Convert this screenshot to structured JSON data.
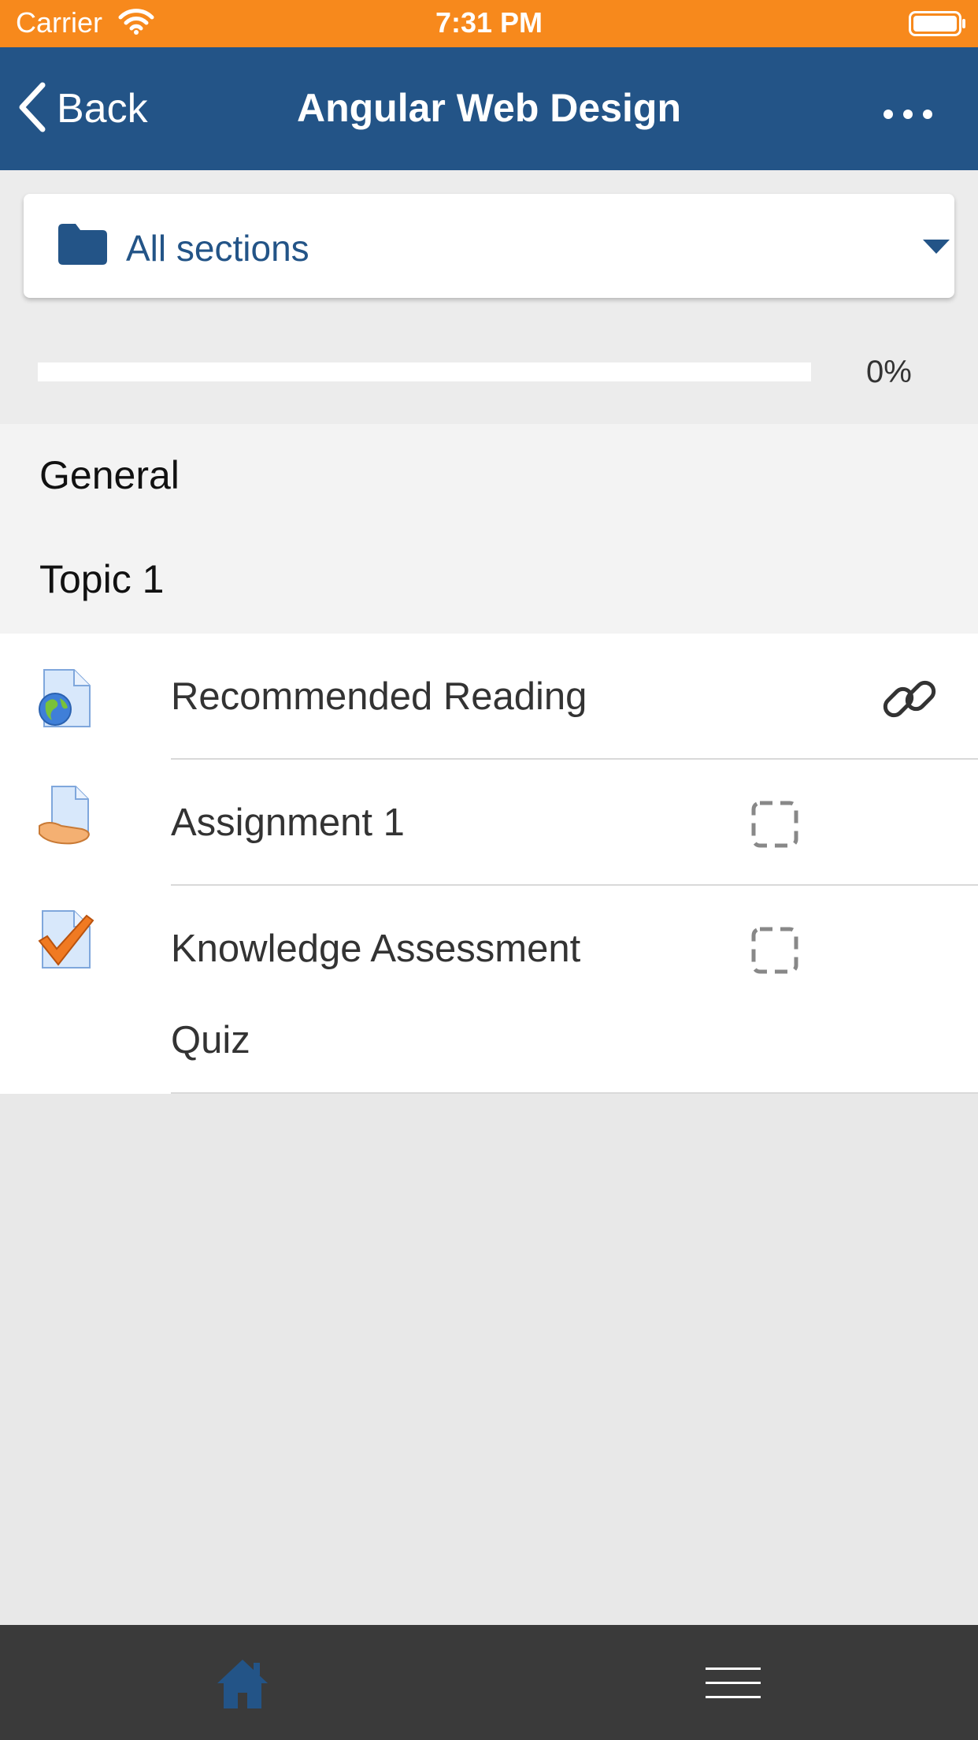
{
  "status_bar": {
    "carrier": "Carrier",
    "time": "7:31 PM"
  },
  "nav": {
    "back_label": "Back",
    "title": "Angular Web Design",
    "more_icon": "more-icon"
  },
  "section_selector": {
    "label": "All sections",
    "icon": "folder-icon"
  },
  "progress": {
    "value": 0,
    "label": "0%"
  },
  "sections": [
    {
      "label": "General"
    },
    {
      "label": "Topic 1"
    }
  ],
  "activities": [
    {
      "label": "Recommended Reading",
      "icon": "url-resource-icon",
      "status_icon": "link-icon"
    },
    {
      "label": "Assignment 1",
      "icon": "assignment-icon",
      "status_icon": "completion-checkbox-icon"
    },
    {
      "label_line1": "Knowledge Assessment",
      "label_line2": "Quiz",
      "icon": "quiz-icon",
      "status_icon": "completion-checkbox-icon"
    }
  ],
  "tabs": [
    {
      "icon": "home-icon"
    },
    {
      "icon": "menu-icon"
    }
  ],
  "colors": {
    "status_bar": "#f7891c",
    "nav_bar": "#235487",
    "accent": "#235487",
    "tab_bar": "#3a3a3a"
  }
}
